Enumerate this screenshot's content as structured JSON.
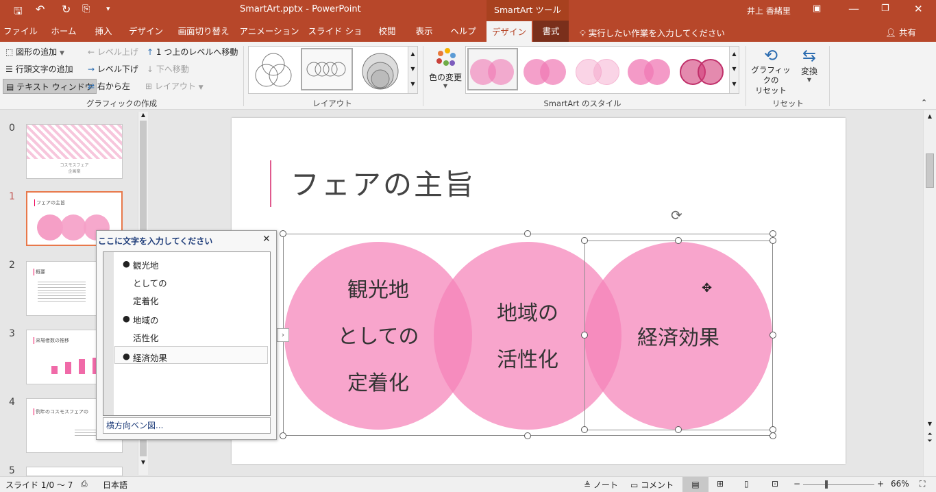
{
  "titlebar": {
    "filename": "SmartArt.pptx",
    "dash": "-",
    "app": "PowerPoint",
    "context_tool": "SmartArt ツール",
    "user": "井上 香緒里"
  },
  "tabs": {
    "file": "ファイル",
    "home": "ホーム",
    "insert": "挿入",
    "design": "デザイン",
    "transitions": "画面切り替え",
    "animations": "アニメーション",
    "slideshow": "スライド ショー",
    "review": "校閲",
    "view": "表示",
    "help": "ヘルプ",
    "sa_design": "デザイン",
    "sa_format": "書式",
    "tellme": "実行したい作業を入力してください",
    "share": "共有"
  },
  "ribbon": {
    "add_shape": "図形の追加",
    "add_bullet": "行頭文字の追加",
    "text_pane": "テキスト ウィンドウ",
    "promote": "レベル上げ",
    "demote": "レベル下げ",
    "rtl": "右から左",
    "move_up": "1 つ上のレベルへ移動",
    "move_down": "下へ移動",
    "layout_btn": "レイアウト",
    "group_create": "グラフィックの作成",
    "group_layout": "レイアウト",
    "change_colors": "色の変更",
    "group_styles": "SmartArt のスタイル",
    "reset_graphic_1": "グラフィックの",
    "reset_graphic_2": "リセット",
    "convert": "変換",
    "group_reset": "リセット"
  },
  "slides": [
    {
      "num": "0",
      "t1": "コスモスフェア",
      "t2": "企画案"
    },
    {
      "num": "1",
      "title": "フェアの主旨"
    },
    {
      "num": "2",
      "title": "概要"
    },
    {
      "num": "3",
      "title": "来場者数の推移"
    },
    {
      "num": "4",
      "title": "例年のコスモスフェアの"
    },
    {
      "num": "5"
    }
  ],
  "slide": {
    "title": "フェアの主旨",
    "c1_l1": "観光地",
    "c1_l2": "としての",
    "c1_l3": "定着化",
    "c2_l1": "地域の",
    "c2_l2": "活性化",
    "c3": "経済効果"
  },
  "textpane": {
    "header": "ここに文字を入力してください",
    "l1": "観光地",
    "l2": "としての",
    "l3": "定着化",
    "l4": "地域の",
    "l5": "活性化",
    "l6": "経済効果",
    "footer": "横方向ベン図..."
  },
  "status": {
    "slide": "スライド 1/0 ～ 7",
    "lang": "日本語",
    "notes": "ノート",
    "comments": "コメント",
    "zoom": "66%"
  },
  "colors": {
    "accent": "#b7472a",
    "pink": "#f48fbf",
    "slide_pink": "#f59fc6"
  }
}
